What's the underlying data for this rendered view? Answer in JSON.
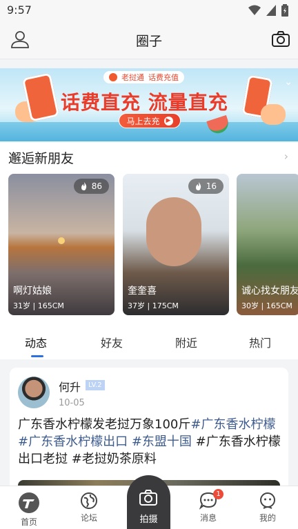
{
  "status_bar": {
    "time": "9:57"
  },
  "header": {
    "title": "圈子"
  },
  "banner": {
    "brand": "老挝通",
    "tag": "话费充值",
    "headline": "话费直充 流量直充",
    "cta": "马上去充"
  },
  "meet_section": {
    "title": "邂逅新朋友"
  },
  "cards": [
    {
      "name": "啊灯姑娘",
      "age": "31岁",
      "height": "165CM",
      "heat": "86"
    },
    {
      "name": "奎奎喜",
      "age": "37岁",
      "height": "175CM",
      "heat": "16"
    },
    {
      "name": "诚心找女朋友",
      "age": "30岁",
      "height": "165CM",
      "heat": ""
    }
  ],
  "tabs": [
    {
      "label": "动态"
    },
    {
      "label": "好友"
    },
    {
      "label": "附近"
    },
    {
      "label": "热门"
    }
  ],
  "post": {
    "author": "何升",
    "level": "LV.2",
    "date": "10-05",
    "text_plain": "广东香水柠檬发老挝万象100斤",
    "tag1": "#广东香水柠檬",
    "tag2": "#广东香水柠檬出口",
    "tag3": "#东盟十国",
    "tag4": "#广东香水柠檬出口老挝",
    "tag5": "#老挝奶茶原料"
  },
  "bottom_nav": {
    "home": "首页",
    "forum": "论坛",
    "shoot": "拍摄",
    "messages": "消息",
    "messages_badge": "1",
    "mine": "我的"
  },
  "colors": {
    "accent": "#2e6fe0",
    "tag": "#3e5b8e",
    "badge": "#ec4b3a"
  }
}
